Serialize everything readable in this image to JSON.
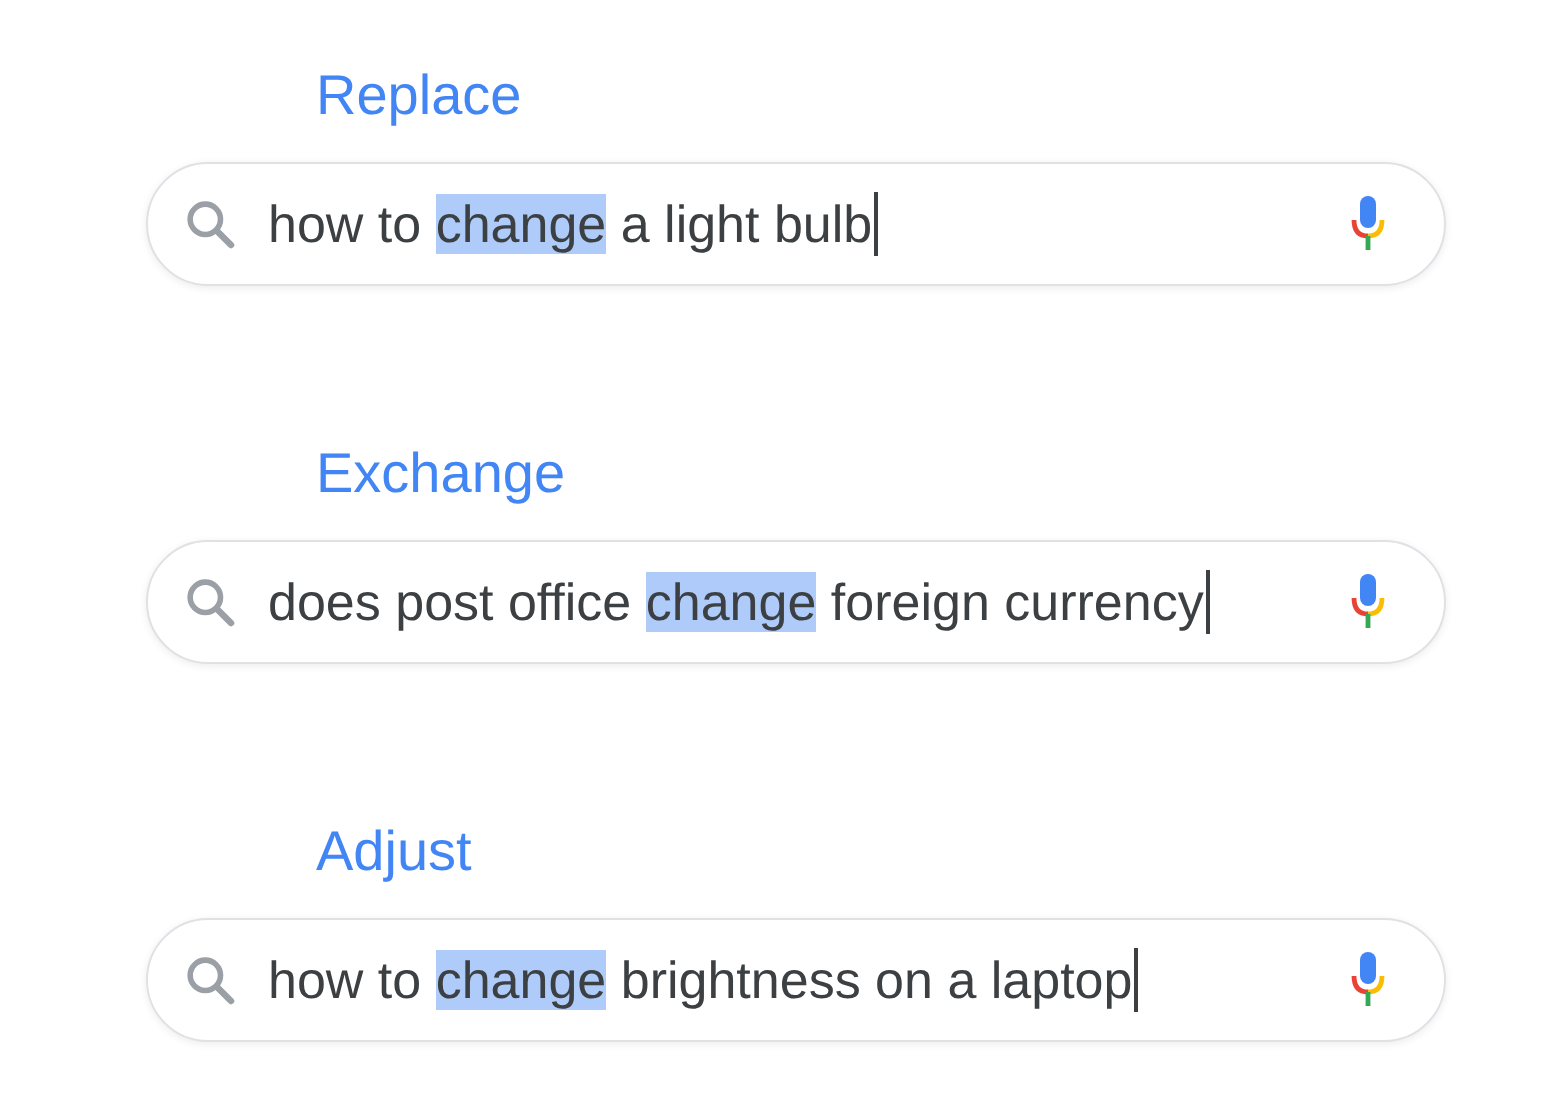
{
  "groups": [
    {
      "label": "Replace",
      "query_before": "how to ",
      "highlight": "change",
      "query_after": " a light bulb"
    },
    {
      "label": "Exchange",
      "query_before": "does post office ",
      "highlight": "change",
      "query_after": " foreign currency"
    },
    {
      "label": "Adjust",
      "query_before": "how to ",
      "highlight": "change",
      "query_after": " brightness on a laptop"
    }
  ]
}
